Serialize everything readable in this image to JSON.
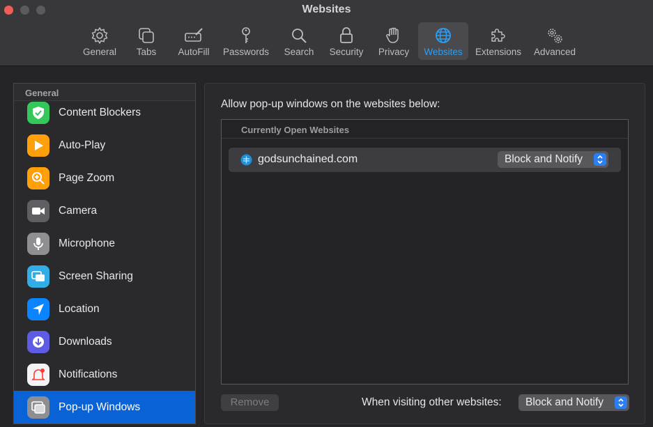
{
  "window": {
    "title": "Websites"
  },
  "toolbar": {
    "tabs": [
      {
        "label": "General",
        "icon": "gear-icon"
      },
      {
        "label": "Tabs",
        "icon": "tabs-icon"
      },
      {
        "label": "AutoFill",
        "icon": "pencil-field-icon"
      },
      {
        "label": "Passwords",
        "icon": "key-icon"
      },
      {
        "label": "Search",
        "icon": "magnifier-icon"
      },
      {
        "label": "Security",
        "icon": "lock-icon"
      },
      {
        "label": "Privacy",
        "icon": "hand-icon"
      },
      {
        "label": "Websites",
        "icon": "globe-icon",
        "active": true
      },
      {
        "label": "Extensions",
        "icon": "puzzle-icon"
      },
      {
        "label": "Advanced",
        "icon": "gears-icon"
      }
    ]
  },
  "sidebar": {
    "header": "General",
    "items": [
      {
        "label": "Content Blockers",
        "icon": "shield-check-icon",
        "color": "#34c759"
      },
      {
        "label": "Auto-Play",
        "icon": "play-icon",
        "color": "#ff9f0a"
      },
      {
        "label": "Page Zoom",
        "icon": "zoom-icon",
        "color": "#ff9f0a"
      },
      {
        "label": "Camera",
        "icon": "camera-icon",
        "color": "#5f5f63"
      },
      {
        "label": "Microphone",
        "icon": "microphone-icon",
        "color": "#8e8e93"
      },
      {
        "label": "Screen Sharing",
        "icon": "screen-sharing-icon",
        "color": "#32ade6"
      },
      {
        "label": "Location",
        "icon": "location-arrow-icon",
        "color": "#0a84ff"
      },
      {
        "label": "Downloads",
        "icon": "download-icon",
        "color": "#5e5ce6"
      },
      {
        "label": "Notifications",
        "icon": "bell-icon",
        "color": "#f2f2f7"
      },
      {
        "label": "Pop-up Windows",
        "icon": "popup-windows-icon",
        "color": "#8e8e93",
        "selected": true
      }
    ]
  },
  "main": {
    "allow_label": "Allow pop-up windows on the websites below:",
    "list_header": "Currently Open Websites",
    "sites": [
      {
        "name": "godsunchained.com",
        "setting": "Block and Notify",
        "icon": "site-favicon-icon"
      }
    ],
    "remove_label": "Remove",
    "visiting_label": "When visiting other websites:",
    "default_setting": "Block and Notify"
  },
  "colors": {
    "accent": "#2aa0f4",
    "selection": "#0a63d6",
    "popup_arrow": "#2b7ff0"
  }
}
